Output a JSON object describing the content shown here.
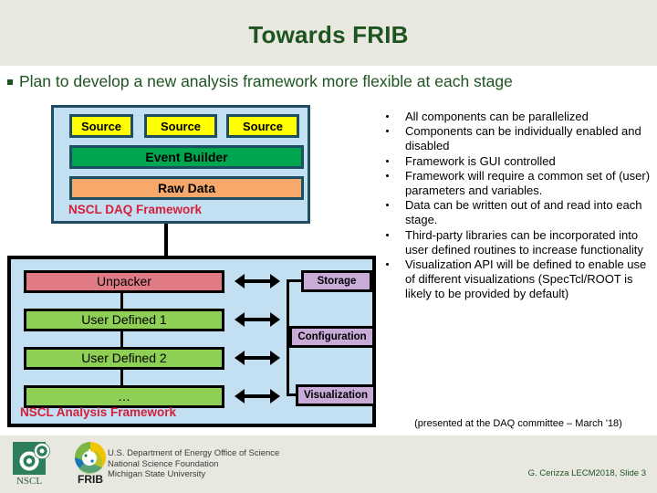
{
  "slide": {
    "title": "Towards FRIB",
    "main_bullet": "Plan to develop a new analysis framework more flexible at each stage"
  },
  "daq_framework": {
    "label": "NSCL DAQ Framework",
    "sources": [
      "Source",
      "Source",
      "Source"
    ],
    "event_builder": "Event Builder",
    "raw_data": "Raw Data",
    "colors": {
      "panel_bg": "#c3dff2",
      "panel_border": "#1d4e63",
      "source": "#ffff00",
      "event_builder": "#00a550",
      "raw_data": "#f6a96a",
      "label": "#d61f39"
    }
  },
  "analysis_framework": {
    "label": "NSCL Analysis Framework",
    "stages": [
      "Unpacker",
      "User Defined 1",
      "User Defined 2",
      "…"
    ],
    "services": [
      "Storage",
      "Configuration",
      "Visualization"
    ],
    "colors": {
      "panel_bg": "#c3dff2",
      "panel_border": "#000000",
      "unpacker": "#e07b86",
      "user_defined": "#8ed055",
      "service": "#c8abd7",
      "label": "#d61f39"
    }
  },
  "bullets": [
    "All components can be parallelized",
    "Components can be individually enabled and disabled",
    "Framework is GUI controlled",
    "Framework will require a common set of (user) parameters and variables.",
    "Data can be written out of and read into each stage.",
    "Third-party libraries can be incorporated into user defined routines to increase functionality",
    "Visualization API will be defined to enable use of different visualizations (SpecTcl/ROOT is likely to be provided by default)"
  ],
  "note": "(presented at the DAQ committee – March '18)",
  "footer": {
    "org_lines": [
      "U.S. Department of Energy Office of Science",
      "National Science Foundation",
      "Michigan State University"
    ],
    "nscl_label": "NSCL",
    "frib_label": "FRIB",
    "credit": "G. Cerizza LECM2018, Slide 3"
  }
}
